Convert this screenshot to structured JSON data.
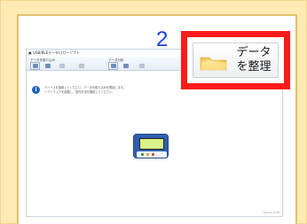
{
  "step": {
    "number": "2"
  },
  "highlight_button": {
    "label_line1": "データ",
    "label_line2": "を整理",
    "icon": "folder-icon",
    "highlight_color": "#ff1a1a"
  },
  "app": {
    "title": "▣ USB/BLEデータロガーソフト",
    "groups": [
      "データを取り込み",
      "データ分析"
    ],
    "info_text_line1": "デバイスを接続してください。データの取り込みを開始します。",
    "info_text_line2": "ソフトウェアを起動し、操作方法を確認してください。",
    "status": "Version 2.30"
  },
  "colors": {
    "outer_bg": "#fdebb3",
    "frame_border": "#e6c06a",
    "step_num": "#1a3fe0"
  }
}
